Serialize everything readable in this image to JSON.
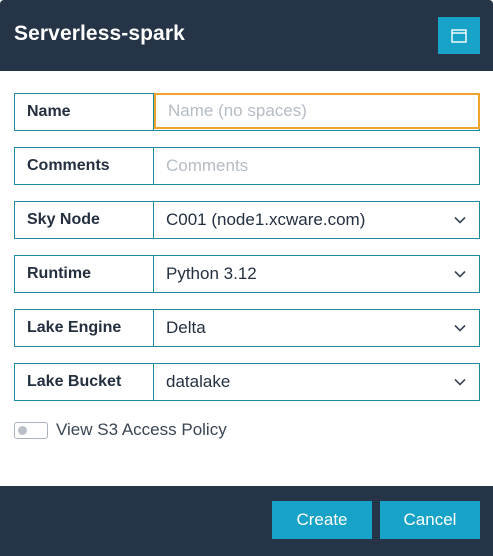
{
  "dialog": {
    "title": "Serverless-spark",
    "window_icon": "window-icon"
  },
  "form": {
    "name": {
      "label": "Name",
      "placeholder": "Name (no spaces)",
      "value": ""
    },
    "comments": {
      "label": "Comments",
      "placeholder": "Comments",
      "value": ""
    },
    "sky_node": {
      "label": "Sky Node",
      "value": "C001 (node1.xcware.com)"
    },
    "runtime": {
      "label": "Runtime",
      "value": "Python 3.12"
    },
    "lake_engine": {
      "label": "Lake Engine",
      "value": "Delta"
    },
    "lake_bucket": {
      "label": "Lake Bucket",
      "value": "datalake"
    }
  },
  "toggle": {
    "label": "View S3 Access Policy",
    "on": false
  },
  "footer": {
    "create_label": "Create",
    "cancel_label": "Cancel"
  },
  "colors": {
    "header_bg": "#253446",
    "accent": "#17a2c7",
    "border": "#1a8aa0",
    "focus": "#f0a32a"
  }
}
